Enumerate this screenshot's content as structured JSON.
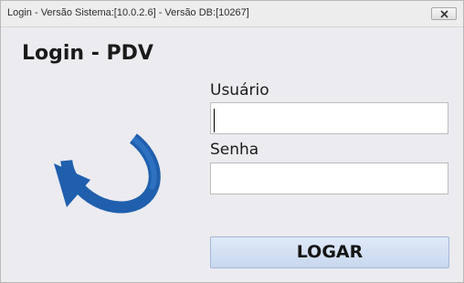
{
  "window": {
    "title": "Login - Versão Sistema:[10.0.2.6] - Versão DB:[10267]"
  },
  "header": {
    "title": "Login - PDV"
  },
  "form": {
    "username_label": "Usuário",
    "username_value": "",
    "password_label": "Senha",
    "password_value": "",
    "submit_label": "LOGAR"
  },
  "icons": {
    "close": "close-icon",
    "logo": "refresh-arrow-icon"
  },
  "colors": {
    "logo_blue": "#1f5fad",
    "button_bg": "#d3e0f3",
    "window_bg": "#ebebf0"
  }
}
